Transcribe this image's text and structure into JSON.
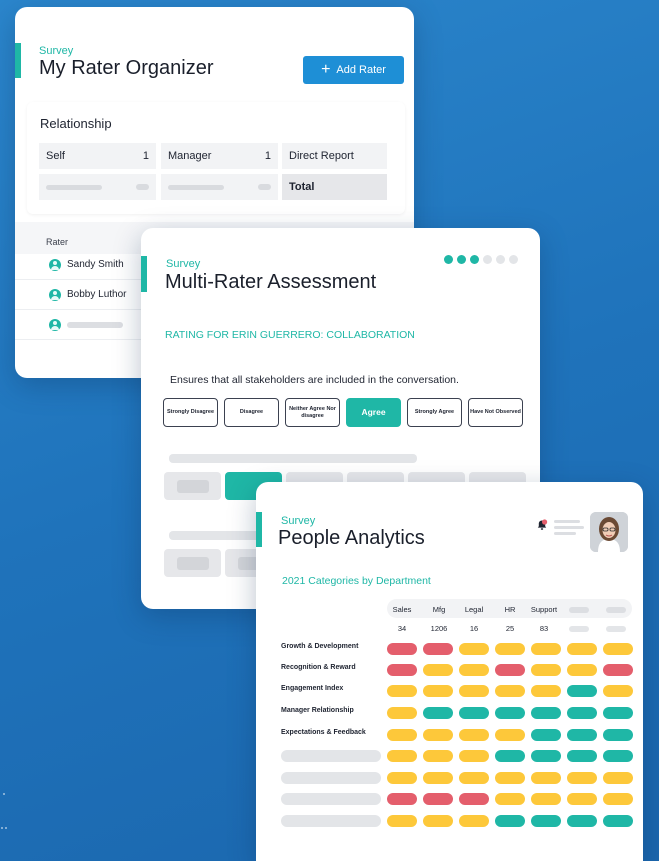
{
  "organizer": {
    "kicker": "Survey",
    "title": "My Rater Organizer",
    "add_button": "Add Rater",
    "relationship_title": "Relationship",
    "relationships": [
      {
        "label": "Self",
        "count": "1"
      },
      {
        "label": "Manager",
        "count": "1"
      },
      {
        "label": "Direct Report",
        "count": ""
      }
    ],
    "total_label": "Total",
    "rater_header": "Rater",
    "raters": [
      "Sandy Smith",
      "Bobby Luthor"
    ]
  },
  "assessment": {
    "kicker": "Survey",
    "title": "Multi-Rater Assessment",
    "step_total": 6,
    "step_current": 3,
    "rating_for": "RATING FOR ERIN GUERRERO: COLLABORATION",
    "statement": "Ensures that all stakeholders are included in the conversation.",
    "options": [
      "Strongly Disagree",
      "Disagree",
      "Neither Agree Nor disagree",
      "Agree",
      "Strongly Agree",
      "Have Not Observed"
    ],
    "selected": "Agree"
  },
  "analytics": {
    "kicker": "Survey",
    "title": "People Analytics",
    "notification_count": "1",
    "subtitle": "2021 Categories by Department",
    "departments": [
      "Sales",
      "Mfg",
      "Legal",
      "HR",
      "Support"
    ],
    "counts": [
      "34",
      "1206",
      "16",
      "25",
      "83"
    ],
    "categories": [
      "Growth & Development",
      "Recognition & Reward",
      "Engagement Index",
      "Manager Relationship",
      "Expectations & Feedback"
    ],
    "colors": {
      "red": "#e45e6c",
      "yellow": "#fdc83a",
      "teal": "#1fb7a6",
      "accent": "#1fb7a6",
      "button": "#1e8fd6"
    },
    "heatmap": [
      [
        "red",
        "red",
        "yellow",
        "yellow",
        "yellow",
        "yellow",
        "yellow"
      ],
      [
        "red",
        "yellow",
        "yellow",
        "red",
        "yellow",
        "yellow",
        "red"
      ],
      [
        "yellow",
        "yellow",
        "yellow",
        "yellow",
        "yellow",
        "teal",
        "yellow"
      ],
      [
        "yellow",
        "teal",
        "teal",
        "teal",
        "teal",
        "teal",
        "teal"
      ],
      [
        "yellow",
        "yellow",
        "yellow",
        "yellow",
        "teal",
        "teal",
        "teal"
      ],
      [
        "yellow",
        "yellow",
        "yellow",
        "teal",
        "teal",
        "teal",
        "teal"
      ],
      [
        "yellow",
        "yellow",
        "yellow",
        "yellow",
        "yellow",
        "yellow",
        "yellow"
      ],
      [
        "red",
        "red",
        "red",
        "yellow",
        "yellow",
        "yellow",
        "yellow"
      ],
      [
        "yellow",
        "yellow",
        "yellow",
        "teal",
        "teal",
        "teal",
        "teal"
      ]
    ]
  }
}
